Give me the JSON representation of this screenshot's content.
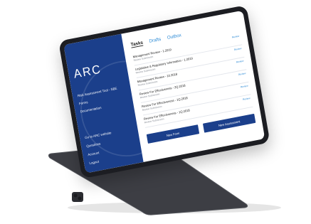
{
  "app": {
    "logo": "ARC",
    "sidebar_top": [
      "Risk Assessment Tool - SBE",
      "Forms",
      "Documentation"
    ],
    "sidebar_bottom": [
      "Go to ARC website",
      "Questions",
      "Account",
      "Logout"
    ]
  },
  "tabs": [
    {
      "label": "Tasks",
      "active": true
    },
    {
      "label": "Drafts",
      "active": false
    },
    {
      "label": "Outbox",
      "active": false
    }
  ],
  "list": [
    {
      "title": "Management Review - 1.2019",
      "subtitle": "Review Submission",
      "action": "Review"
    },
    {
      "title": "Legislative & Regulatory Information - 1.2019",
      "subtitle": "Review Submission",
      "action": "Review"
    },
    {
      "title": "Management Review - 10.2018",
      "subtitle": "Review Submission",
      "action": "Review"
    },
    {
      "title": "Review For Effectiveness - 2Q.2018",
      "subtitle": "Review Submission",
      "action": "Review"
    },
    {
      "title": "Review For Effectiveness - 1Q.2018",
      "subtitle": "Review Submission",
      "action": "Review"
    },
    {
      "title": "Review For Effectiveness - 1Q.2018",
      "subtitle": "Review Submission",
      "action": "Review"
    }
  ],
  "buttons": {
    "new_form": "New Form",
    "new_assessment": "New Assessment"
  },
  "colors": {
    "brand": "#1b3f8b",
    "accent": "#2e8bd6",
    "device": "#3a3b40"
  }
}
